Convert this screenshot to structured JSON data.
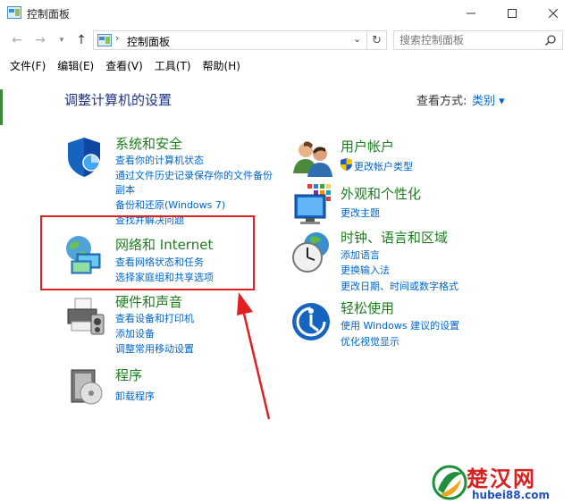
{
  "window": {
    "title": "控制面板"
  },
  "address": {
    "crumb": "控制面板"
  },
  "search": {
    "placeholder": "搜索控制面板"
  },
  "menu": [
    "文件(F)",
    "编辑(E)",
    "查看(V)",
    "工具(T)",
    "帮助(H)"
  ],
  "content": {
    "title": "调整计算机的设置",
    "view_by_label": "查看方式:",
    "view_by_value": "类别 ▾"
  },
  "categories": {
    "system": {
      "title": "系统和安全",
      "links": [
        "查看你的计算机状态",
        "通过文件历史记录保存你的文件备份",
        "副本",
        "备份和还原(Windows 7)",
        "查找并解决问题"
      ]
    },
    "network": {
      "title": "网络和 Internet",
      "links": [
        "查看网络状态和任务",
        "选择家庭组和共享选项"
      ]
    },
    "hardware": {
      "title": "硬件和声音",
      "links": [
        "查看设备和打印机",
        "添加设备",
        "调整常用移动设置"
      ]
    },
    "programs": {
      "title": "程序",
      "links": [
        "卸载程序"
      ]
    },
    "user": {
      "title": "用户帐户",
      "links": [
        "更改帐户类型"
      ]
    },
    "appearance": {
      "title": "外观和个性化",
      "links": [
        "更改主题"
      ]
    },
    "clock": {
      "title": "时钟、语言和区域",
      "links": [
        "添加语言",
        "更换输入法",
        "更改日期、时间或数字格式"
      ]
    },
    "ease": {
      "title": "轻松使用",
      "links": [
        "使用 Windows 建议的设置",
        "优化视觉显示"
      ]
    }
  },
  "watermark": {
    "name": "楚汉网",
    "url": "hubei88.com"
  },
  "colors": {
    "highlight": "#e02020",
    "link": "#0066cc",
    "category_title": "#1e7e1e",
    "page_title": "#1e3287"
  }
}
